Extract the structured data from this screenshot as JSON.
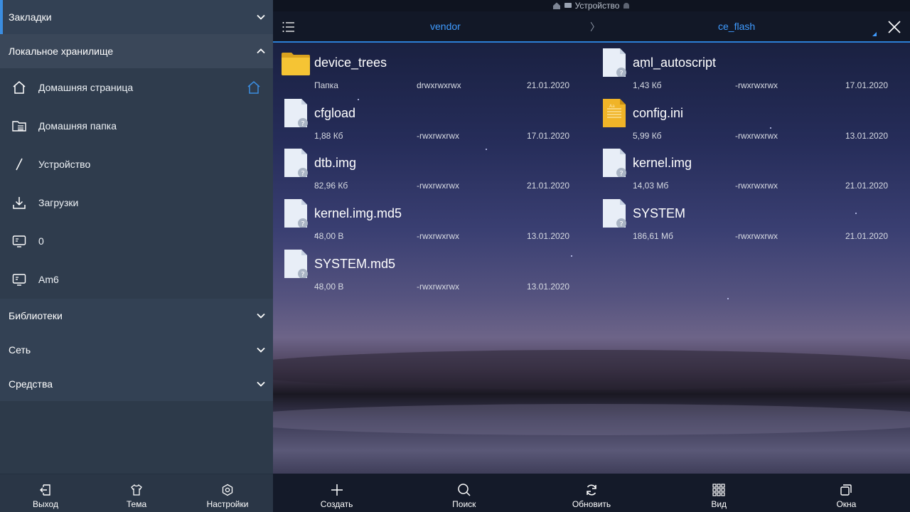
{
  "sidebar": {
    "sections": {
      "bookmarks": "Закладки",
      "local_storage": "Локальное хранилище",
      "libraries": "Библиотеки",
      "network": "Сеть",
      "tools": "Средства"
    },
    "items": [
      {
        "label": "Домашняя страница",
        "icon": "home-icon"
      },
      {
        "label": "Домашняя папка",
        "icon": "home-folder-icon"
      },
      {
        "label": "Устройство",
        "icon": "slash-icon"
      },
      {
        "label": "Загрузки",
        "icon": "download-icon"
      },
      {
        "label": "0",
        "icon": "storage-device-icon"
      },
      {
        "label": "Am6",
        "icon": "storage-device-icon"
      }
    ],
    "bottom": {
      "exit": "Выход",
      "theme": "Тема",
      "settings": "Настройки"
    }
  },
  "status_bar": {
    "title": "Устройство"
  },
  "path_bar": {
    "crumbs": [
      "vendor",
      "ce_flash"
    ],
    "separator": "〉"
  },
  "files": [
    {
      "name": "device_trees",
      "size": "Папка",
      "perm": "drwxrwxrwx",
      "date": "21.01.2020",
      "type": "folder"
    },
    {
      "name": "aml_autoscript",
      "size": "1,43 Кб",
      "perm": "-rwxrwxrwx",
      "date": "17.01.2020",
      "type": "unknown"
    },
    {
      "name": "cfgload",
      "size": "1,88 Кб",
      "perm": "-rwxrwxrwx",
      "date": "17.01.2020",
      "type": "unknown"
    },
    {
      "name": "config.ini",
      "size": "5,99 Кб",
      "perm": "-rwxrwxrwx",
      "date": "13.01.2020",
      "type": "text"
    },
    {
      "name": "dtb.img",
      "size": "82,96 Кб",
      "perm": "-rwxrwxrwx",
      "date": "21.01.2020",
      "type": "unknown"
    },
    {
      "name": "kernel.img",
      "size": "14,03 Мб",
      "perm": "-rwxrwxrwx",
      "date": "21.01.2020",
      "type": "unknown"
    },
    {
      "name": "kernel.img.md5",
      "size": "48,00 B",
      "perm": "-rwxrwxrwx",
      "date": "13.01.2020",
      "type": "unknown"
    },
    {
      "name": "SYSTEM",
      "size": "186,61 Мб",
      "perm": "-rwxrwxrwx",
      "date": "21.01.2020",
      "type": "unknown"
    },
    {
      "name": "SYSTEM.md5",
      "size": "48,00 B",
      "perm": "-rwxrwxrwx",
      "date": "13.01.2020",
      "type": "unknown"
    }
  ],
  "toolbar": {
    "create": "Создать",
    "search": "Поиск",
    "refresh": "Обновить",
    "view": "Вид",
    "windows": "Окна"
  },
  "colors": {
    "accent": "#3b8de0",
    "breadcrumb": "#3f9bff",
    "folder": "#f2c232",
    "text_file": "#f0b428"
  }
}
